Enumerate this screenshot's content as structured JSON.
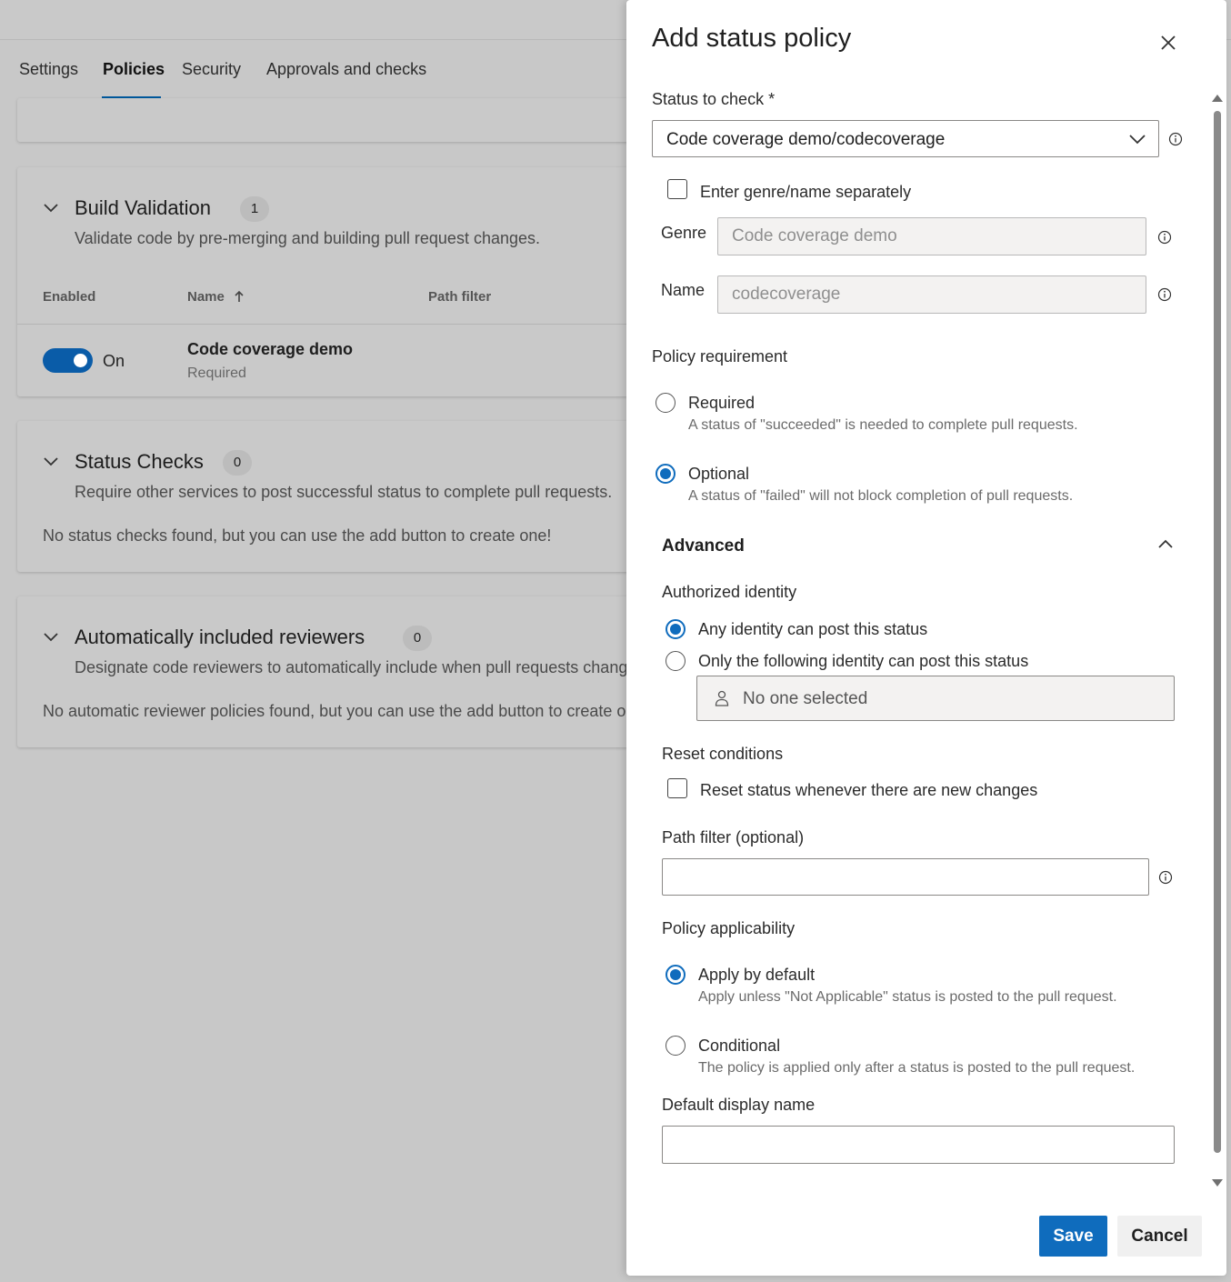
{
  "tabs": [
    {
      "label": "Settings"
    },
    {
      "label": "Policies"
    },
    {
      "label": "Security"
    },
    {
      "label": "Approvals and checks"
    }
  ],
  "active_tab": "Policies",
  "build_validation": {
    "title": "Build Validation",
    "count": "1",
    "description": "Validate code by pre-merging and building pull request changes.",
    "columns": {
      "enabled": "Enabled",
      "name": "Name",
      "path_filter": "Path filter"
    },
    "sort_icon": "arrow-up-icon",
    "row": {
      "toggle_state": "On",
      "name": "Code coverage demo",
      "requirement": "Required"
    }
  },
  "status_checks": {
    "title": "Status Checks",
    "count": "0",
    "description": "Require other services to post successful status to complete pull requests.",
    "empty_text": "No status checks found, but you can use the add button to create one!"
  },
  "reviewers": {
    "title": "Automatically included reviewers",
    "count": "0",
    "description": "Designate code reviewers to automatically include when pull requests change certain areas of code.",
    "empty_text": "No automatic reviewer policies found, but you can use the add button to create one!"
  },
  "panel": {
    "title": "Add status policy",
    "status_label": "Status to check *",
    "status_value": "Code coverage demo/codecoverage",
    "enter_separately_label": "Enter genre/name separately",
    "genre_label": "Genre",
    "genre_placeholder": "Code coverage demo",
    "name_label": "Name",
    "name_placeholder": "codecoverage",
    "policy_requirement_label": "Policy requirement",
    "required_label": "Required",
    "required_desc": "A status of \"succeeded\" is needed to complete pull requests.",
    "optional_label": "Optional",
    "optional_desc": "A status of \"failed\" will not block completion of pull requests.",
    "policy_requirement_selected": "Optional",
    "advanced_title": "Advanced",
    "authorized_identity_label": "Authorized identity",
    "any_identity_label": "Any identity can post this status",
    "only_identity_label": "Only the following identity can post this status",
    "identity_selected_selected": "Any identity can post this status",
    "identity_picker_text": "No one selected",
    "reset_conditions_label": "Reset conditions",
    "reset_status_label": "Reset status whenever there are new changes",
    "path_filter_label": "Path filter (optional)",
    "path_filter_value": "",
    "policy_applicability_label": "Policy applicability",
    "apply_default_label": "Apply by default",
    "apply_default_desc": "Apply unless \"Not Applicable\" status is posted to the pull request.",
    "conditional_label": "Conditional",
    "conditional_desc": "The policy is applied only after a status is posted to the pull request.",
    "policy_applicability_selected": "Apply by default",
    "default_display_name_label": "Default display name",
    "default_display_name_value": "",
    "save_label": "Save",
    "cancel_label": "Cancel"
  },
  "colors": {
    "accent": "#0f6cbd",
    "toggle_on": "#0a5ca8",
    "overlay_bg": "#c8c8c8",
    "panel_bg": "#ffffff"
  }
}
